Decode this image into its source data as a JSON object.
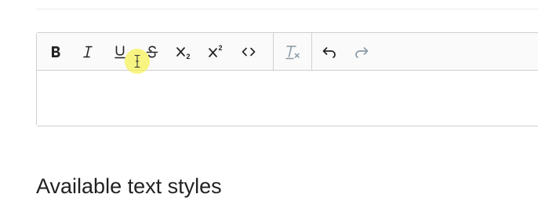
{
  "toolbar": {
    "buttons": [
      {
        "icon": "bold-icon",
        "enabled": true
      },
      {
        "icon": "italic-icon",
        "enabled": true
      },
      {
        "icon": "underline-icon",
        "enabled": true
      },
      {
        "icon": "strikethrough-icon",
        "enabled": true
      },
      {
        "icon": "subscript-icon",
        "enabled": true
      },
      {
        "icon": "superscript-icon",
        "enabled": true
      },
      {
        "icon": "code-icon",
        "enabled": true
      },
      {
        "icon": "clear-formatting-icon",
        "enabled": false
      },
      {
        "icon": "undo-icon",
        "enabled": true
      },
      {
        "icon": "redo-icon",
        "enabled": false
      }
    ]
  },
  "editor": {
    "value": ""
  },
  "section": {
    "heading": "Available text styles"
  },
  "colors": {
    "icon_active": "#222222",
    "icon_disabled": "#8a9aa6",
    "border": "#cfcfcf",
    "cursor_highlight": "#f6f25a"
  }
}
